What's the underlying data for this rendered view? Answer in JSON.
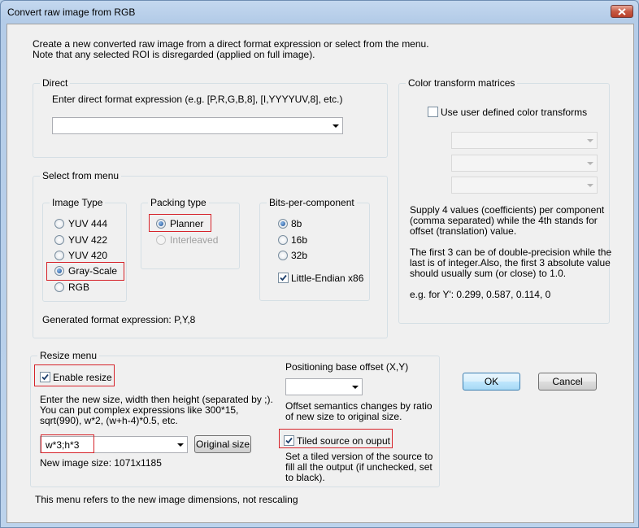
{
  "window": {
    "title": "Convert raw image from RGB"
  },
  "intro": {
    "line1": "Create a new converted raw image from a direct format expression or select from the menu.",
    "line2": "Note that any selected ROI is disregarded (applied on full image)."
  },
  "direct": {
    "group_label": "Direct",
    "prompt": "Enter direct format expression (e.g. [P,R,G,B,8], [I,YYYYUV,8], etc.)",
    "value": ""
  },
  "select_menu": {
    "group_label": "Select from menu",
    "image_type": {
      "label": "Image Type",
      "options": [
        "YUV 444",
        "YUV 422",
        "YUV 420",
        "Gray-Scale",
        "RGB"
      ],
      "selected": "Gray-Scale"
    },
    "packing_type": {
      "label": "Packing type",
      "options": [
        "Planner",
        "Interleaved"
      ],
      "selected": "Planner"
    },
    "bits": {
      "label": "Bits-per-component",
      "options": [
        "8b",
        "16b",
        "32b"
      ],
      "selected": "8b",
      "little_endian_label": "Little-Endian x86",
      "little_endian_checked": true
    },
    "generated_label": "Generated format expression: P,Y,8"
  },
  "color_transform": {
    "group_label": "Color transform matrices",
    "checkbox_label": "Use user defined color transforms",
    "checked": false,
    "help1a": "Supply 4 values (coefficients) per component",
    "help1b": "(comma separated) while the 4th stands for",
    "help1c": "offset (translation) value.",
    "help2a": "The first 3 can be of double-precision while the",
    "help2b": "last is of integer.Also, the first 3 absolute value",
    "help2c": "should usually sum (or close) to 1.0.",
    "example": "e.g. for Y': 0.299, 0.587, 0.114, 0"
  },
  "resize": {
    "group_label": "Resize menu",
    "enable_label": "Enable resize",
    "enable_checked": true,
    "help1": "Enter the new size, width then height (separated by ;).",
    "help2": "You can put complex expressions like 300*15,",
    "help3": "sqrt(990), w*2, (w+h-4)*0.5, etc.",
    "size_value": "w*3;h*3",
    "original_size_button": "Original size",
    "new_size_label": "New image size: 1071x1185",
    "positioning_label": "Positioning base offset (X,Y)",
    "offset_value": "",
    "offset_help1": "Offset semantics changes by ratio",
    "offset_help2": "of new size to original size.",
    "tiled_label": "Tiled source on ouput",
    "tiled_checked": true,
    "tiled_help1": "Set a tiled version of the source to",
    "tiled_help2": "fill all the output (if unchecked, set",
    "tiled_help3": "to black).",
    "footer_note": "This menu refers to the new image dimensions, not rescaling"
  },
  "buttons": {
    "ok": "OK",
    "cancel": "Cancel"
  }
}
